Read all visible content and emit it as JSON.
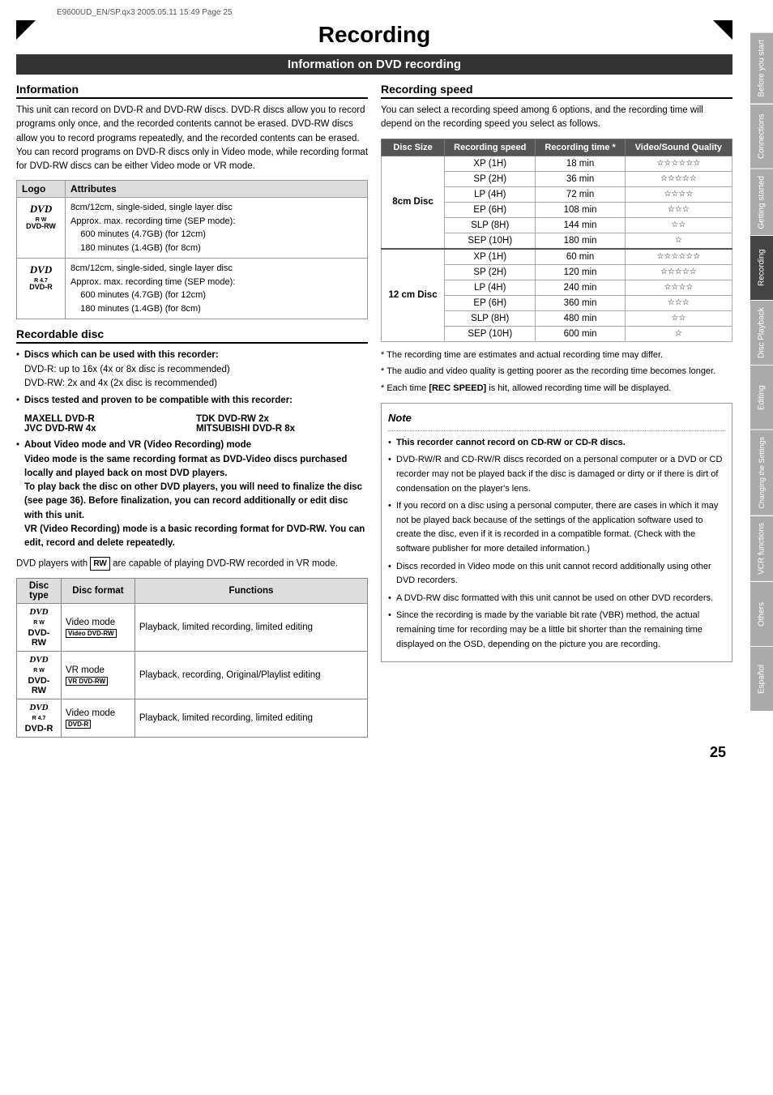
{
  "file_info": "E9600UD_EN/SP.qx3  2005.05.11  15:49  Page 25",
  "page_title": "Recording",
  "section_header": "Information on DVD recording",
  "sidebar_tabs": [
    {
      "label": "Before you start",
      "active": false
    },
    {
      "label": "Connections",
      "active": false
    },
    {
      "label": "Getting started",
      "active": false
    },
    {
      "label": "Recording",
      "active": true
    },
    {
      "label": "Disc Playback",
      "active": false
    },
    {
      "label": "Editing",
      "active": false
    },
    {
      "label": "Changing the Settings",
      "active": false
    },
    {
      "label": "VCR functions",
      "active": false
    },
    {
      "label": "Others",
      "active": false
    },
    {
      "label": "Español",
      "active": false
    }
  ],
  "information": {
    "title": "Information",
    "body": "This unit can record on DVD-R and DVD-RW discs. DVD-R discs allow you to record programs only once, and the recorded contents cannot be erased. DVD-RW discs allow you to record programs repeatedly, and the recorded contents can be erased. You can record programs on DVD-R discs only in Video mode, while recording format for DVD-RW discs can be either Video mode or VR mode."
  },
  "logo_table": {
    "col1": "Logo",
    "col2": "Attributes",
    "rows": [
      {
        "logo": "DVD-RW",
        "attrs": "8cm/12cm, single-sided, single layer disc\nApprox. max. recording time (SEP mode):\n600 minutes (4.7GB) (for 12cm)\n180 minutes (1.4GB) (for 8cm)"
      },
      {
        "logo": "DVD-R",
        "attrs": "8cm/12cm, single-sided, single layer disc\nApprox. max. recording time (SEP mode):\n600 minutes (4.7GB) (for 12cm)\n180 minutes (1.4GB) (for 8cm)"
      }
    ]
  },
  "recordable_disc": {
    "title": "Recordable disc",
    "bullets": [
      {
        "bold": "Discs which can be used with this recorder:",
        "text": "DVD-R: up to 16x (4x or 8x disc is recommended)\nDVD-RW: 2x and 4x (2x disc is recommended)"
      },
      {
        "bold": "Discs tested and proven to be compatible with this recorder:",
        "text": ""
      }
    ],
    "brands": [
      "MAXELL DVD-R",
      "TDK DVD-RW 2x",
      "JVC DVD-RW 4x",
      "MITSUBISHI DVD-R 8x"
    ],
    "vr_note": {
      "intro": "About Video mode and VR (Video Recording) mode",
      "body": "Video mode is the same recording format as DVD-Video discs purchased locally and played back on most DVD players.\nTo play back the disc on other DVD players, you will need to finalize the disc (see page 36). Before finalization, you can record additionally or edit disc with this unit.\nVR (Video Recording) mode is a basic recording format for DVD-RW. You can edit, record and delete repeatedly.",
      "rw_text": "DVD players with",
      "rw_suffix": "are capable of playing DVD-RW recorded in VR mode."
    }
  },
  "disc_type_table": {
    "headers": [
      "Disc type",
      "Disc format",
      "Functions"
    ],
    "rows": [
      {
        "logo": "DVD-RW",
        "format": "Video mode",
        "format_badge": "Video DVD-RW",
        "functions": "Playback, limited recording, limited editing"
      },
      {
        "logo": "DVD-RW",
        "format": "VR mode",
        "format_badge": "VR DVD-RW",
        "functions": "Playback, recording, Original/Playlist editing"
      },
      {
        "logo": "DVD-R",
        "format": "Video mode",
        "format_badge": "DVD-R",
        "functions": "Playback, limited recording, limited editing"
      }
    ]
  },
  "recording_speed": {
    "title": "Recording speed",
    "intro": "You can select a recording speed among 6 options, and the recording time will depend on the recording speed you select as follows.",
    "table_headers": [
      "Disc Size",
      "Recording speed",
      "Recording time *",
      "Video/Sound Quality"
    ],
    "disc_8cm": {
      "label": "8cm Disc",
      "rows": [
        {
          "speed": "XP (1H)",
          "time": "18 min",
          "quality": "☆☆☆☆☆☆"
        },
        {
          "speed": "SP (2H)",
          "time": "36 min",
          "quality": "☆☆☆☆☆"
        },
        {
          "speed": "LP (4H)",
          "time": "72 min",
          "quality": "☆☆☆☆"
        },
        {
          "speed": "EP (6H)",
          "time": "108 min",
          "quality": "☆☆☆"
        },
        {
          "speed": "SLP (8H)",
          "time": "144 min",
          "quality": "☆☆"
        },
        {
          "speed": "SEP (10H)",
          "time": "180 min",
          "quality": "☆"
        }
      ]
    },
    "disc_12cm": {
      "label": "12 cm Disc",
      "rows": [
        {
          "speed": "XP (1H)",
          "time": "60 min",
          "quality": "☆☆☆☆☆☆"
        },
        {
          "speed": "SP (2H)",
          "time": "120 min",
          "quality": "☆☆☆☆☆"
        },
        {
          "speed": "LP (4H)",
          "time": "240 min",
          "quality": "☆☆☆☆"
        },
        {
          "speed": "EP (6H)",
          "time": "360 min",
          "quality": "☆☆☆"
        },
        {
          "speed": "SLP (8H)",
          "time": "480 min",
          "quality": "☆☆"
        },
        {
          "speed": "SEP (10H)",
          "time": "600 min",
          "quality": "☆"
        }
      ]
    },
    "footnotes": [
      "* The recording time are estimates and actual recording time may differ.",
      "* The audio and video quality is getting poorer as the recording time becomes longer.",
      "* Each time [REC SPEED] is hit, allowed recording time will be displayed."
    ],
    "rec_speed_bold": "[REC SPEED]"
  },
  "note_box": {
    "title": "Note",
    "items": [
      {
        "bold": "This recorder cannot record on CD-RW or CD-R discs.",
        "text": ""
      },
      {
        "bold": "",
        "text": "DVD-RW/R and CD-RW/R discs recorded on a personal computer or a DVD or CD recorder may not be played back if the disc is damaged or dirty or if there is dirt of condensation on the player's lens."
      },
      {
        "bold": "",
        "text": "If you record on a disc using a personal computer, there are cases in which it may not be played back because of the settings of the application software used to create the disc, even if it is recorded in a compatible format. (Check with the software publisher for more detailed information.)"
      },
      {
        "bold": "",
        "text": "Discs recorded in Video mode on this unit cannot record additionally using other DVD recorders."
      },
      {
        "bold": "",
        "text": "A DVD-RW disc formatted with this unit cannot be used on other DVD recorders."
      },
      {
        "bold": "",
        "text": "Since the recording is made by the variable bit rate (VBR) method, the actual remaining time for recording may be a little bit shorter than the remaining time displayed on the OSD, depending on the picture you are recording."
      }
    ]
  },
  "page_number": "25"
}
